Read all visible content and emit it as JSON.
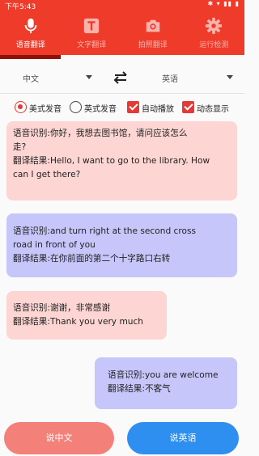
{
  "status": {
    "time": "下午5:43",
    "icons": "✱ ▾ ▮▮ ▮"
  },
  "tabs": [
    {
      "label": "语音翻译",
      "icon": "microphone-icon",
      "active": true
    },
    {
      "label": "文字翻译",
      "icon": "text-t-icon",
      "active": false
    },
    {
      "label": "拍照翻译",
      "icon": "camera-icon",
      "active": false
    },
    {
      "label": "运行检测",
      "icon": "gear-icon",
      "active": false
    }
  ],
  "languages": {
    "source": "中文",
    "target": "英语",
    "swap_icon": "swap-arrows-icon"
  },
  "options": {
    "american": "美式发音",
    "british": "英式发音",
    "autoplay": "自动播放",
    "dynamic": "动态显示",
    "selected_pronunciation": "美式发音",
    "accent_color": "#e53935"
  },
  "messages": [
    {
      "lang": "cn",
      "lines": [
        "语音识别:你好，我想去图书馆，请问应该怎么",
        "走?",
        "翻译结果:Hello, I want to go to the library. How",
        "can I get there?"
      ]
    },
    {
      "lang": "en",
      "lines": [
        "语音识别:and turn right at the second cross",
        "road in front of you",
        "翻译结果:在你前面的第二个十字路口右转"
      ]
    },
    {
      "lang": "cn",
      "lines": [
        "语音识别:谢谢，非常感谢",
        "翻译结果:Thank you very much"
      ]
    },
    {
      "lang": "en",
      "lines": [
        "语音识别:you are welcome",
        "翻译结果:不客气"
      ]
    }
  ],
  "buttons": {
    "speak_chinese": "说中文",
    "speak_english": "说英语"
  },
  "colors": {
    "primary": "#ef3b2a",
    "cn_bubble": "#fdd5d3",
    "en_bubble": "#c6c6fb",
    "cn_button": "#f4807a",
    "en_button": "#2f8ff0"
  }
}
